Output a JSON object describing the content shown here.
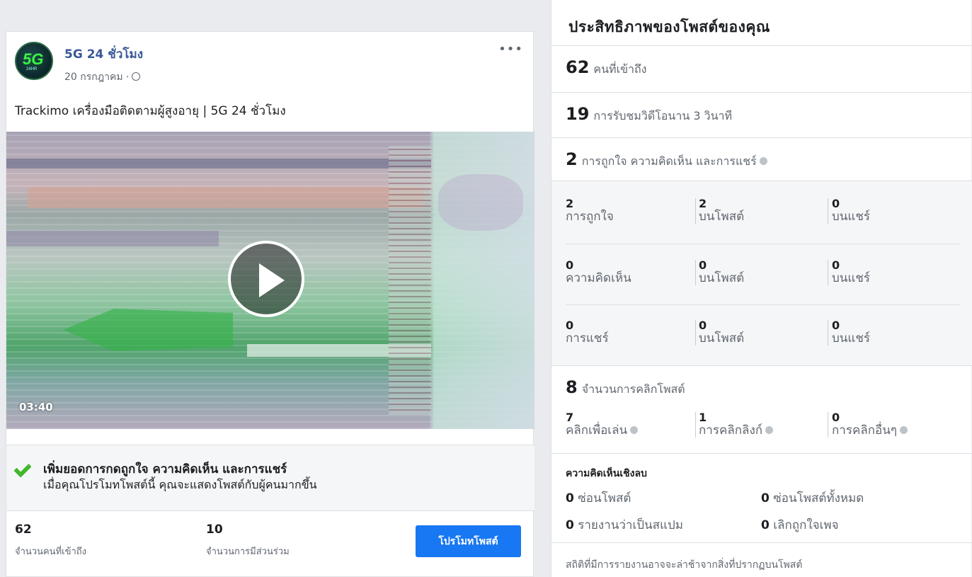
{
  "post": {
    "page_name": "5G 24 ชั่วโมง",
    "date": "20 กรกฎาคม ·",
    "more": "•••",
    "text": "Trackimo เครื่องมือติดตามผู้สูงอายุ | 5G 24 ชั่วโมง",
    "video_duration": "03:40",
    "avatar_logo": "5G",
    "avatar_sub": "24HR"
  },
  "boost": {
    "title": "เพิ่มยอดการกดถูกใจ ความคิดเห็น และการแชร์",
    "subtitle": "เมื่อคุณโปรโมทโพสต์นี้ คุณจะแสดงโพสต์กับผู้คนมากขึ้น"
  },
  "summary": {
    "reach_value": "62",
    "reach_label": "จำนวนคนที่เข้าถึง",
    "engagement_value": "10",
    "engagement_label": "จำนวนการมีส่วนร่วม",
    "promote_button": "โปรโมทโพสต์"
  },
  "insights": {
    "title": "ประสิทธิภาพของโพสต์ของคุณ",
    "reach": {
      "value": "62",
      "label": "คนที่เข้าถึง"
    },
    "video_views": {
      "value": "19",
      "label": "การรับชมวิดีโอนาน 3 วินาที"
    },
    "reactions": {
      "value": "2",
      "label": "การถูกใจ ความคิดเห็น และการแชร์"
    },
    "grid": [
      {
        "values": [
          "2",
          "2",
          "0"
        ],
        "labels": [
          "การถูกใจ",
          "บนโพสต์",
          "บนแชร์"
        ]
      },
      {
        "values": [
          "0",
          "0",
          "0"
        ],
        "labels": [
          "ความคิดเห็น",
          "บนโพสต์",
          "บนแชร์"
        ]
      },
      {
        "values": [
          "0",
          "0",
          "0"
        ],
        "labels": [
          "การแชร์",
          "บนโพสต์",
          "บนแชร์"
        ]
      }
    ],
    "clicks": {
      "value": "8",
      "label": "จำนวนการคลิกโพสต์"
    },
    "click_breakdown": [
      {
        "value": "7",
        "label": "คลิกเพื่อเล่น"
      },
      {
        "value": "1",
        "label": "การคลิกลิงก์"
      },
      {
        "value": "0",
        "label": "การคลิกอื่นๆ"
      }
    ],
    "negative_title": "ความคิดเห็นเชิงลบ",
    "negative": [
      {
        "value": "0",
        "label": "ซ่อนโพสต์"
      },
      {
        "value": "0",
        "label": "ซ่อนโพสต์ทั้งหมด"
      },
      {
        "value": "0",
        "label": "รายงานว่าเป็นสแปม"
      },
      {
        "value": "0",
        "label": "เลิกถูกใจเพจ"
      }
    ],
    "footnote": "สถิติที่มีการรายงานอาจจะล่าช้าจากสิ่งที่ปรากฏบนโพสต์"
  }
}
